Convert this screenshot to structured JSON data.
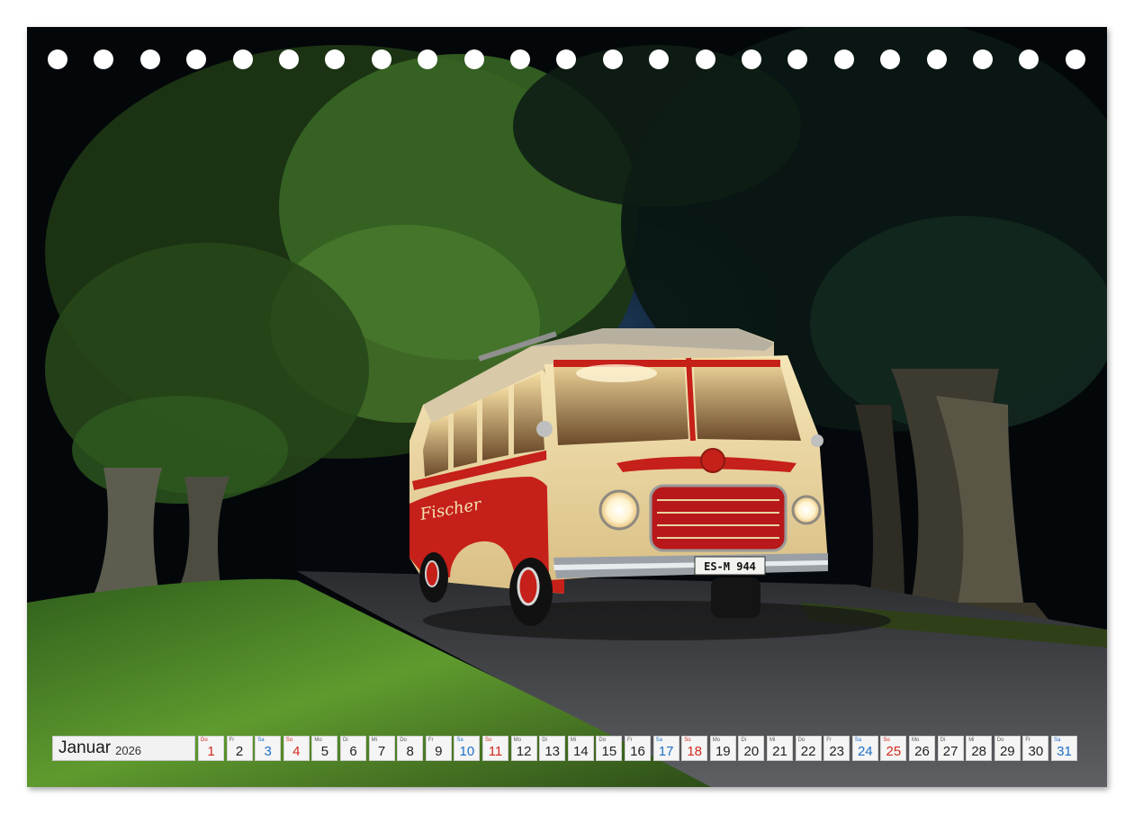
{
  "calendar": {
    "month": "Januar",
    "year": "2026",
    "days": [
      {
        "wd": "Do",
        "n": "1",
        "type": "sun"
      },
      {
        "wd": "Fr",
        "n": "2",
        "type": "week"
      },
      {
        "wd": "Sa",
        "n": "3",
        "type": "sat"
      },
      {
        "wd": "So",
        "n": "4",
        "type": "sun"
      },
      {
        "wd": "Mo",
        "n": "5",
        "type": "week"
      },
      {
        "wd": "Di",
        "n": "6",
        "type": "week"
      },
      {
        "wd": "Mi",
        "n": "7",
        "type": "week"
      },
      {
        "wd": "Do",
        "n": "8",
        "type": "week"
      },
      {
        "wd": "Fr",
        "n": "9",
        "type": "week"
      },
      {
        "wd": "Sa",
        "n": "10",
        "type": "sat"
      },
      {
        "wd": "So",
        "n": "11",
        "type": "sun"
      },
      {
        "wd": "Mo",
        "n": "12",
        "type": "week"
      },
      {
        "wd": "Di",
        "n": "13",
        "type": "week"
      },
      {
        "wd": "Mi",
        "n": "14",
        "type": "week"
      },
      {
        "wd": "Do",
        "n": "15",
        "type": "week"
      },
      {
        "wd": "Fr",
        "n": "16",
        "type": "week"
      },
      {
        "wd": "Sa",
        "n": "17",
        "type": "sat"
      },
      {
        "wd": "So",
        "n": "18",
        "type": "sun"
      },
      {
        "wd": "Mo",
        "n": "19",
        "type": "week"
      },
      {
        "wd": "Di",
        "n": "20",
        "type": "week"
      },
      {
        "wd": "Mi",
        "n": "21",
        "type": "week"
      },
      {
        "wd": "Do",
        "n": "22",
        "type": "week"
      },
      {
        "wd": "Fr",
        "n": "23",
        "type": "week"
      },
      {
        "wd": "Sa",
        "n": "24",
        "type": "sat"
      },
      {
        "wd": "So",
        "n": "25",
        "type": "sun"
      },
      {
        "wd": "Mo",
        "n": "26",
        "type": "week"
      },
      {
        "wd": "Di",
        "n": "27",
        "type": "week"
      },
      {
        "wd": "Mi",
        "n": "28",
        "type": "week"
      },
      {
        "wd": "Do",
        "n": "29",
        "type": "week"
      },
      {
        "wd": "Fr",
        "n": "30",
        "type": "week"
      },
      {
        "wd": "Sa",
        "n": "31",
        "type": "sat"
      }
    ]
  },
  "photo": {
    "plate": "ES-M 944",
    "lettering": "Fischer",
    "colors": {
      "bus_cream": "#efd9a0",
      "bus_red": "#c8211b",
      "foliage": "#2f5a22",
      "grass": "#4f8a2a",
      "road": "#55575a"
    }
  },
  "binding": {
    "hole_count": 23
  }
}
